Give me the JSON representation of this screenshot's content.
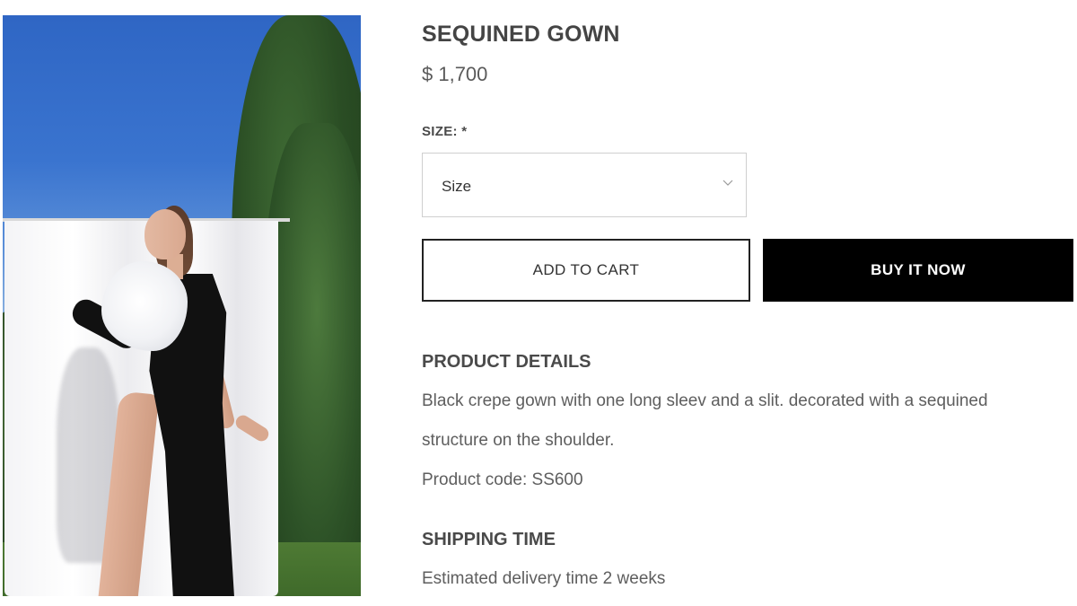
{
  "product": {
    "title": "SEQUINED GOWN",
    "price": "$ 1,700"
  },
  "size": {
    "label": "SIZE: *",
    "selected": "Size"
  },
  "actions": {
    "add_to_cart": "ADD TO CART",
    "buy_now": "BUY IT NOW"
  },
  "details": {
    "heading": "PRODUCT DETAILS",
    "description_line1": "Black crepe gown with one long sleev and a slit. decorated with a sequined",
    "description_line2": "structure on the shoulder.",
    "product_code": "Product code: SS600"
  },
  "shipping": {
    "heading": "SHIPPING TIME",
    "delivery": "Estimated delivery time 2 weeks"
  },
  "icons": {
    "select_chevron": "chevron-down-icon"
  },
  "colors": {
    "buy_button_bg": "#000000",
    "buy_button_text": "#ffffff",
    "cart_button_border": "#222222",
    "select_border": "#cfcfcf"
  }
}
